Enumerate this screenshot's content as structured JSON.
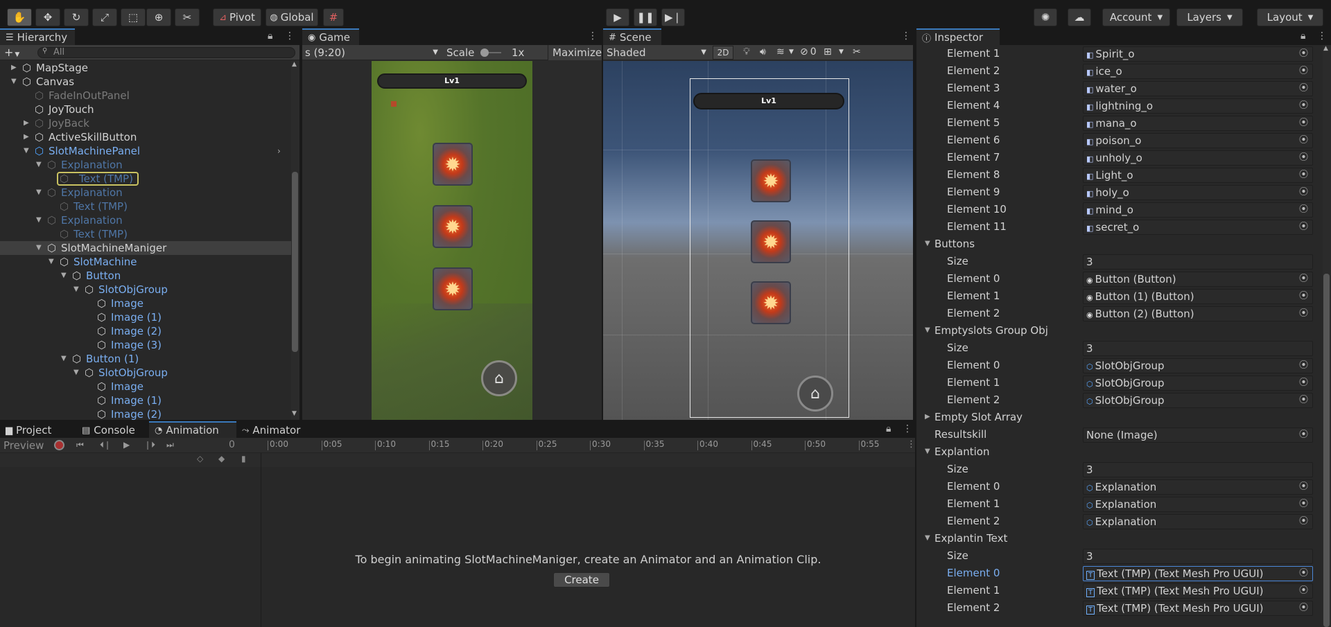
{
  "toolbar": {
    "pivot_label": "Pivot",
    "global_label": "Global",
    "account_label": "Account",
    "layers_label": "Layers",
    "layout_label": "Layout"
  },
  "hierarchy": {
    "tab_label": "Hierarchy",
    "search_placeholder": "All",
    "items": [
      {
        "label": "MapStage",
        "style": "normal"
      },
      {
        "label": "Canvas",
        "style": "normal"
      },
      {
        "label": "FadeInOutPanel",
        "style": "dim"
      },
      {
        "label": "JoyTouch",
        "style": "normal"
      },
      {
        "label": "JoyBack",
        "style": "dim"
      },
      {
        "label": "ActiveSkillButton",
        "style": "normal"
      },
      {
        "label": "SlotMachinePanel",
        "style": "blue"
      },
      {
        "label": "Explanation",
        "style": "dimblue"
      },
      {
        "label": "Text (TMP)",
        "style": "dimblue"
      },
      {
        "label": "Explanation",
        "style": "dimblue"
      },
      {
        "label": "Text (TMP)",
        "style": "dimblue"
      },
      {
        "label": "Explanation",
        "style": "dimblue"
      },
      {
        "label": "Text (TMP)",
        "style": "dimblue"
      },
      {
        "label": "SlotMachineManiger",
        "style": "normal"
      },
      {
        "label": "SlotMachine",
        "style": "blue"
      },
      {
        "label": "Button",
        "style": "blue"
      },
      {
        "label": "SlotObjGroup",
        "style": "blue"
      },
      {
        "label": "Image",
        "style": "blue"
      },
      {
        "label": "Image (1)",
        "style": "blue"
      },
      {
        "label": "Image (2)",
        "style": "blue"
      },
      {
        "label": "Image (3)",
        "style": "blue"
      },
      {
        "label": "Button (1)",
        "style": "blue"
      },
      {
        "label": "SlotObjGroup",
        "style": "blue"
      },
      {
        "label": "Image",
        "style": "blue"
      },
      {
        "label": "Image (1)",
        "style": "blue"
      },
      {
        "label": "Image (2)",
        "style": "blue"
      }
    ]
  },
  "game": {
    "tab_label": "Game",
    "resolution": "s (9:20)",
    "scale_label": "Scale",
    "scale_value": "1x",
    "maximize_label": "Maximize",
    "level_label": "Lv1"
  },
  "scene": {
    "tab_label": "Scene",
    "shading": "Shaded",
    "mode_2d": "2D",
    "hidden_count": "0",
    "level_label": "Lv1"
  },
  "bottom": {
    "tabs": {
      "project": "Project",
      "console": "Console",
      "animation": "Animation",
      "animator": "Animator"
    },
    "preview_label": "Preview",
    "frame_value": "0",
    "timeline": [
      "0:00",
      "0:05",
      "0:10",
      "0:15",
      "0:20",
      "0:25",
      "0:30",
      "0:35",
      "0:40",
      "0:45",
      "0:50",
      "0:55"
    ],
    "message": "To begin animating SlotMachineManiger, create an Animator and an Animation Clip.",
    "create_label": "Create"
  },
  "inspector": {
    "tab_label": "Inspector",
    "rows": [
      {
        "label": "Element 1",
        "value": "Spirit_o",
        "kind": "field",
        "icon": "asset",
        "indent": 2
      },
      {
        "label": "Element 2",
        "value": "ice_o",
        "kind": "field",
        "icon": "asset",
        "indent": 2
      },
      {
        "label": "Element 3",
        "value": "water_o",
        "kind": "field",
        "icon": "asset",
        "indent": 2
      },
      {
        "label": "Element 4",
        "value": "lightning_o",
        "kind": "field",
        "icon": "asset",
        "indent": 2
      },
      {
        "label": "Element 5",
        "value": "mana_o",
        "kind": "field",
        "icon": "asset",
        "indent": 2
      },
      {
        "label": "Element 6",
        "value": "poison_o",
        "kind": "field",
        "icon": "asset",
        "indent": 2
      },
      {
        "label": "Element 7",
        "value": "unholy_o",
        "kind": "field",
        "icon": "asset",
        "indent": 2
      },
      {
        "label": "Element 8",
        "value": "Light_o",
        "kind": "field",
        "icon": "asset",
        "indent": 2
      },
      {
        "label": "Element 9",
        "value": "holy_o",
        "kind": "field",
        "icon": "asset",
        "indent": 2
      },
      {
        "label": "Element 10",
        "value": "mind_o",
        "kind": "field",
        "icon": "asset",
        "indent": 2
      },
      {
        "label": "Element 11",
        "value": "secret_o",
        "kind": "field",
        "icon": "asset",
        "indent": 2
      },
      {
        "label": "Buttons",
        "kind": "header",
        "indent": 1
      },
      {
        "label": "Size",
        "value": "3",
        "kind": "plain",
        "indent": 2
      },
      {
        "label": "Element 0",
        "value": "Button (Button)",
        "kind": "field",
        "icon": "button",
        "indent": 2
      },
      {
        "label": "Element 1",
        "value": "Button (1) (Button)",
        "kind": "field",
        "icon": "button",
        "indent": 2
      },
      {
        "label": "Element 2",
        "value": "Button (2) (Button)",
        "kind": "field",
        "icon": "button",
        "indent": 2
      },
      {
        "label": "Emptyslots Group Obj",
        "kind": "header",
        "indent": 1
      },
      {
        "label": "Size",
        "value": "3",
        "kind": "plain",
        "indent": 2
      },
      {
        "label": "Element 0",
        "value": "SlotObjGroup",
        "kind": "field",
        "icon": "cube",
        "indent": 2
      },
      {
        "label": "Element 1",
        "value": "SlotObjGroup",
        "kind": "field",
        "icon": "cube",
        "indent": 2
      },
      {
        "label": "Element 2",
        "value": "SlotObjGroup",
        "kind": "field",
        "icon": "cube",
        "indent": 2
      },
      {
        "label": "Empty Slot Array",
        "kind": "collapsed",
        "indent": 1
      },
      {
        "label": "Resultskill",
        "value": "None (Image)",
        "kind": "field",
        "icon": "none",
        "indent": 1
      },
      {
        "label": "Explantion",
        "kind": "header",
        "indent": 1
      },
      {
        "label": "Size",
        "value": "3",
        "kind": "plain",
        "indent": 2
      },
      {
        "label": "Element 0",
        "value": "Explanation",
        "kind": "field",
        "icon": "cube",
        "indent": 2
      },
      {
        "label": "Element 1",
        "value": "Explanation",
        "kind": "field",
        "icon": "cube",
        "indent": 2
      },
      {
        "label": "Element 2",
        "value": "Explanation",
        "kind": "field",
        "icon": "cube",
        "indent": 2
      },
      {
        "label": "Explantin Text",
        "kind": "header",
        "indent": 1
      },
      {
        "label": "Size",
        "value": "3",
        "kind": "plain",
        "indent": 2
      },
      {
        "label": "Element 0",
        "value": "Text (TMP) (Text Mesh Pro UGUI)",
        "kind": "field",
        "icon": "text",
        "indent": 2,
        "highlight": true
      },
      {
        "label": "Element 1",
        "value": "Text (TMP) (Text Mesh Pro UGUI)",
        "kind": "field",
        "icon": "text",
        "indent": 2
      },
      {
        "label": "Element 2",
        "value": "Text (TMP) (Text Mesh Pro UGUI)",
        "kind": "field",
        "icon": "text",
        "indent": 2
      }
    ]
  }
}
